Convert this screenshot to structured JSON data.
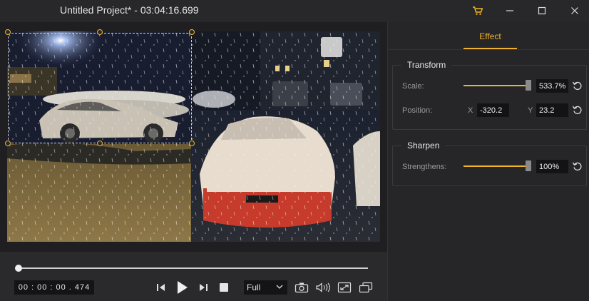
{
  "window": {
    "title": "Untitled Project* - 03:04:16.699"
  },
  "titlebar_icons": [
    "cart-icon",
    "minimize-icon",
    "maximize-icon",
    "close-icon"
  ],
  "playback": {
    "current_time": "00 : 00 : 00 . 474",
    "progress": 0.0,
    "zoom_option": "Full"
  },
  "panel": {
    "tab": "Effect",
    "transform": {
      "title": "Transform",
      "scale_label": "Scale:",
      "scale_value": "533.7%",
      "position_label": "Position:",
      "x_label": "X",
      "x_value": "-320.2",
      "y_label": "Y",
      "y_value": "23.2"
    },
    "sharpen": {
      "title": "Sharpen",
      "strength_label": "Strengthens:",
      "strength_value": "100%"
    }
  },
  "colors": {
    "accent": "#f2b12a",
    "bg": "#252528",
    "field": "#131315"
  }
}
